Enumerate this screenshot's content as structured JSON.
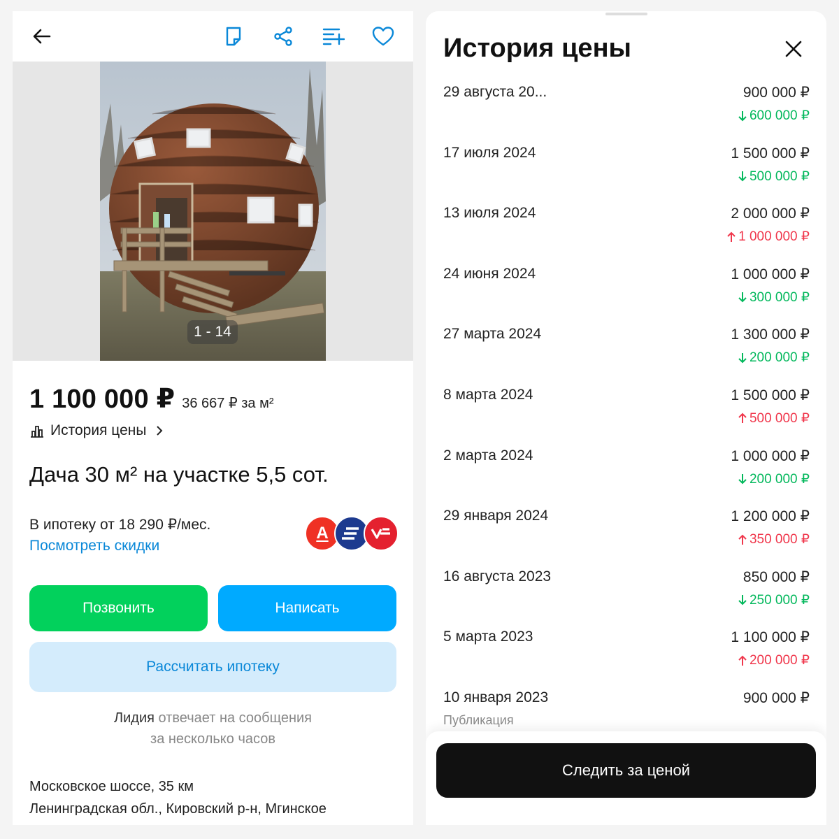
{
  "left": {
    "gallery": {
      "counter": "1 - 14"
    },
    "price": {
      "main": "1 100 000 ₽",
      "per_sqm": "36 667 ₽ за м²"
    },
    "history_link": "История цены",
    "title": "Дача 30 м² на участке 5,5 сот.",
    "mortgage": {
      "text": "В ипотеку от 18 290 ₽/мес.",
      "link": "Посмотреть скидки"
    },
    "banks": [
      {
        "icon": "alfabank-logo",
        "letter": "А",
        "color": "#ef3124"
      },
      {
        "icon": "bank-logo-blue",
        "color": "#1d3a8f"
      },
      {
        "icon": "bank-logo-red",
        "color": "#e4212f"
      }
    ],
    "buttons": {
      "call": "Позвонить",
      "write": "Написать",
      "calc": "Рассчитать ипотеку"
    },
    "reply": {
      "name": "Лидия",
      "line1_rest": " отвечает на сообщения",
      "line2": "за несколько часов"
    },
    "address": {
      "line1": "Московское шоссе, 35 км",
      "line2": "Ленинградская обл., Кировский р-н, Мгинское"
    }
  },
  "right": {
    "title": "История цены",
    "history": [
      {
        "date": "29 августа 20...",
        "price": "900 000 ₽",
        "change": "600 000 ₽",
        "dir": "down"
      },
      {
        "date": "17 июля 2024",
        "price": "1 500 000 ₽",
        "change": "500 000 ₽",
        "dir": "down"
      },
      {
        "date": "13 июля 2024",
        "price": "2 000 000 ₽",
        "change": "1 000 000 ₽",
        "dir": "up"
      },
      {
        "date": "24 июня 2024",
        "price": "1 000 000 ₽",
        "change": "300 000 ₽",
        "dir": "down"
      },
      {
        "date": "27 марта 2024",
        "price": "1 300 000 ₽",
        "change": "200 000 ₽",
        "dir": "down"
      },
      {
        "date": "8 марта 2024",
        "price": "1 500 000 ₽",
        "change": "500 000 ₽",
        "dir": "up"
      },
      {
        "date": "2 марта 2024",
        "price": "1 000 000 ₽",
        "change": "200 000 ₽",
        "dir": "down"
      },
      {
        "date": "29 января 2024",
        "price": "1 200 000 ₽",
        "change": "350 000 ₽",
        "dir": "up"
      },
      {
        "date": "16 августа 2023",
        "price": "850 000 ₽",
        "change": "250 000 ₽",
        "dir": "down"
      },
      {
        "date": "5 марта 2023",
        "price": "1 100 000 ₽",
        "change": "200 000 ₽",
        "dir": "up"
      },
      {
        "date": "10 января 2023",
        "price": "900 000 ₽",
        "note": "Публикация"
      }
    ],
    "watch_button": "Следить за ценой"
  },
  "colors": {
    "green": "#02d15c",
    "blue": "#00aaff",
    "link": "#0a88d8",
    "down": "#03b85c",
    "up": "#f0374c"
  }
}
